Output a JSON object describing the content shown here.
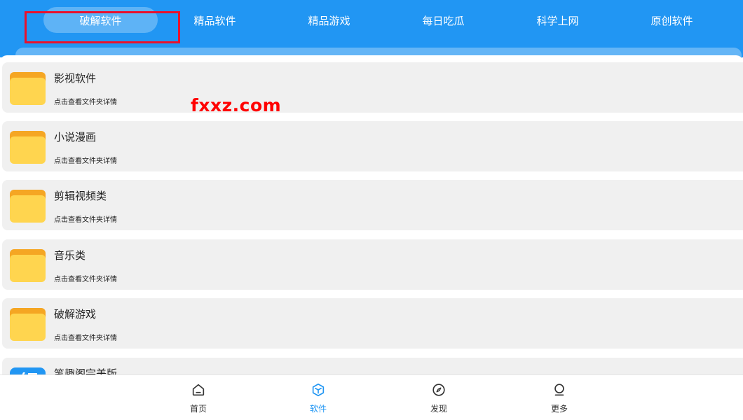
{
  "header": {
    "tabs": [
      {
        "label": "破解软件",
        "active": true
      },
      {
        "label": "精品软件",
        "active": false
      },
      {
        "label": "精品游戏",
        "active": false
      },
      {
        "label": "每日吃瓜",
        "active": false
      },
      {
        "label": "科学上网",
        "active": false
      },
      {
        "label": "原创软件",
        "active": false
      }
    ]
  },
  "folders": [
    {
      "title": "影视软件",
      "subtitle": "点击查看文件夹详情"
    },
    {
      "title": "小说漫画",
      "subtitle": "点击查看文件夹详情"
    },
    {
      "title": "剪辑视频类",
      "subtitle": "点击查看文件夹详情"
    },
    {
      "title": "音乐类",
      "subtitle": "点击查看文件夹详情"
    },
    {
      "title": "破解游戏",
      "subtitle": "点击查看文件夹详情"
    },
    {
      "title": "笔趣阁完美版",
      "subtitle": ""
    }
  ],
  "watermark": "fxxz.com",
  "bottom_nav": [
    {
      "label": "首页",
      "icon": "home-icon",
      "active": false
    },
    {
      "label": "软件",
      "icon": "cube-icon",
      "active": true
    },
    {
      "label": "发现",
      "icon": "compass-icon",
      "active": false
    },
    {
      "label": "更多",
      "icon": "user-icon",
      "active": false
    }
  ],
  "colors": {
    "primary": "#2196f3",
    "highlight": "#e8112d",
    "watermark": "#ff0000",
    "folder": "#ffd54f"
  }
}
